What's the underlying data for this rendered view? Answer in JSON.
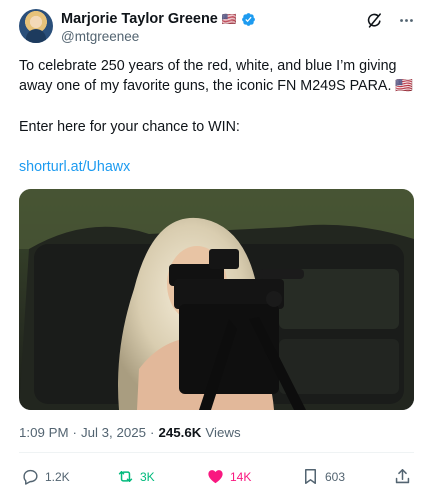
{
  "author": {
    "display_name": "Marjorie Taylor Greene",
    "flag": "🇺🇸",
    "handle": "@mtgreenee",
    "verified_icon": "verified-badge-icon"
  },
  "header_icons": [
    "grok-icon",
    "more-icon"
  ],
  "tweet": {
    "text_line": "To celebrate 250 years of the red, white, and blue I’m giving away one of my favorite guns, the iconic FN M249S PARA.",
    "text_flag": "🇺🇸",
    "text_line2": "Enter here for your chance to WIN:",
    "link": "shorturl.at/Uhawx"
  },
  "media": {
    "alt_icon": "photo-woman-with-machine-gun"
  },
  "meta": {
    "time": "1:09 PM",
    "sep1": "·",
    "date": "Jul 3, 2025",
    "sep2": "·",
    "views_count": "245.6K",
    "views_label": "Views"
  },
  "actions": {
    "reply_count": "1.2K",
    "repost_count": "3K",
    "like_count": "14K",
    "bookmark_count": "603"
  },
  "colors": {
    "accent": "#1d9bf0",
    "repost": "#00ba7c",
    "like": "#f91880",
    "secondary": "#536471"
  }
}
